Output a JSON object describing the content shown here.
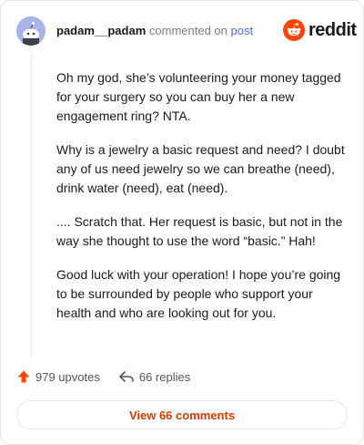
{
  "header": {
    "username": "padam__padam",
    "action_text": "commented on",
    "post_link": "post"
  },
  "logo": {
    "wordmark": "reddit",
    "icon": "reddit-snoo-icon",
    "brand_color": "#ff4500"
  },
  "comment": {
    "paragraphs": [
      "Oh my god, she’s volunteering your money tagged for your surgery so you can buy her a new engagement ring? NTA.",
      "Why is a jewelry a basic request and need? I doubt any of us need jewelry so we can breathe (need), drink water (need), eat (need).",
      ".... Scratch that. Her request is basic, but not in the way she thought to use the word “basic.” Hah!",
      "Good luck with your operation! I hope you’re going to be surrounded by people who support your health and who are looking out for you."
    ]
  },
  "actions": {
    "upvotes_label": "979 upvotes",
    "replies_label": "66 replies",
    "upvote_icon": "upvote-arrow-icon",
    "reply_icon": "reply-arrow-icon"
  },
  "view_button": {
    "label": "View 66 comments",
    "color": "#d93a00"
  }
}
